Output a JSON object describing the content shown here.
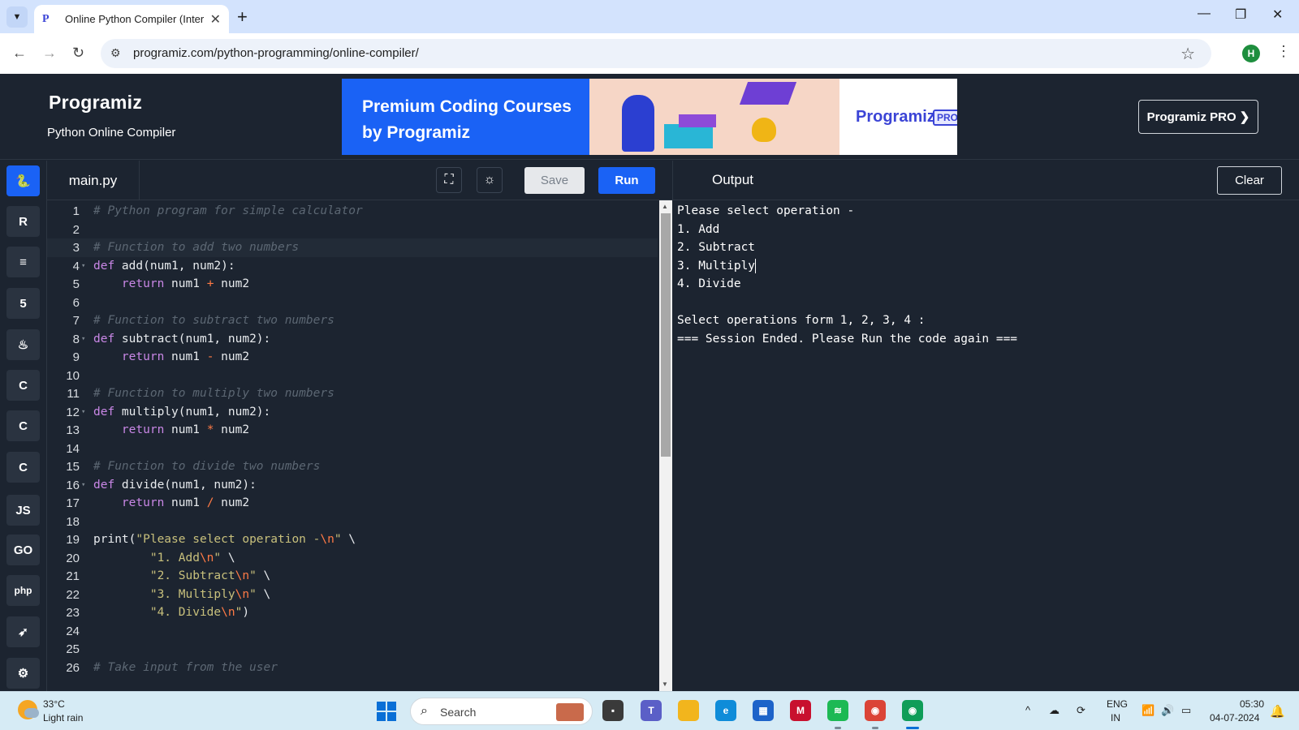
{
  "browser": {
    "tab_title": "Online Python Compiler (Interp",
    "url": "programiz.com/python-programming/online-compiler/"
  },
  "site": {
    "logo": "Programiz",
    "subtitle": "Python Online Compiler",
    "banner_text": "Premium Coding Courses by Programiz",
    "banner_logo": "Programiz",
    "banner_badge": "PRO",
    "pro_button": "Programiz PRO ❯"
  },
  "sidebar": {
    "items": [
      {
        "name": "python",
        "icon": "python-icon",
        "glyph": "🐍",
        "active": true
      },
      {
        "name": "r",
        "icon": "r-icon",
        "glyph": "R",
        "active": false
      },
      {
        "name": "sql",
        "icon": "database-icon",
        "glyph": "≡",
        "active": false
      },
      {
        "name": "html",
        "icon": "html5-icon",
        "glyph": "5",
        "active": false
      },
      {
        "name": "java",
        "icon": "java-icon",
        "glyph": "♨",
        "active": false
      },
      {
        "name": "c",
        "icon": "c-icon",
        "glyph": "C",
        "active": false
      },
      {
        "name": "cpp",
        "icon": "cpp-icon",
        "glyph": "C",
        "active": false
      },
      {
        "name": "csharp",
        "icon": "csharp-icon",
        "glyph": "C",
        "active": false
      },
      {
        "name": "js",
        "icon": "javascript-icon",
        "glyph": "JS",
        "active": false
      },
      {
        "name": "go",
        "icon": "go-icon",
        "glyph": "GO",
        "active": false
      },
      {
        "name": "php",
        "icon": "php-icon",
        "glyph": "php",
        "active": false
      },
      {
        "name": "swift",
        "icon": "swift-icon",
        "glyph": "➶",
        "active": false
      },
      {
        "name": "rust",
        "icon": "rust-icon",
        "glyph": "⚙",
        "active": false
      }
    ]
  },
  "editor": {
    "file_name": "main.py",
    "save_label": "Save",
    "run_label": "Run",
    "lines": [
      {
        "n": "1",
        "fold": false,
        "hl": false,
        "parts": [
          {
            "t": "# Python program for simple calculator",
            "c": "cm"
          }
        ]
      },
      {
        "n": "2",
        "fold": false,
        "hl": false,
        "parts": []
      },
      {
        "n": "3",
        "fold": false,
        "hl": true,
        "parts": [
          {
            "t": "# Function to add two numbers",
            "c": "cm"
          }
        ]
      },
      {
        "n": "4",
        "fold": true,
        "hl": false,
        "parts": [
          {
            "t": "def",
            "c": "kw"
          },
          {
            "t": " add(num1, num2):",
            "c": ""
          }
        ]
      },
      {
        "n": "5",
        "fold": false,
        "hl": false,
        "parts": [
          {
            "t": "    ",
            "c": ""
          },
          {
            "t": "return",
            "c": "kw"
          },
          {
            "t": " num1 ",
            "c": ""
          },
          {
            "t": "+",
            "c": "op"
          },
          {
            "t": " num2",
            "c": ""
          }
        ]
      },
      {
        "n": "6",
        "fold": false,
        "hl": false,
        "parts": []
      },
      {
        "n": "7",
        "fold": false,
        "hl": false,
        "parts": [
          {
            "t": "# Function to subtract two numbers",
            "c": "cm"
          }
        ]
      },
      {
        "n": "8",
        "fold": true,
        "hl": false,
        "parts": [
          {
            "t": "def",
            "c": "kw"
          },
          {
            "t": " subtract(num1, num2):",
            "c": ""
          }
        ]
      },
      {
        "n": "9",
        "fold": false,
        "hl": false,
        "parts": [
          {
            "t": "    ",
            "c": ""
          },
          {
            "t": "return",
            "c": "kw"
          },
          {
            "t": " num1 ",
            "c": ""
          },
          {
            "t": "-",
            "c": "op"
          },
          {
            "t": " num2",
            "c": ""
          }
        ]
      },
      {
        "n": "10",
        "fold": false,
        "hl": false,
        "parts": []
      },
      {
        "n": "11",
        "fold": false,
        "hl": false,
        "parts": [
          {
            "t": "# Function to multiply two numbers",
            "c": "cm"
          }
        ]
      },
      {
        "n": "12",
        "fold": true,
        "hl": false,
        "parts": [
          {
            "t": "def",
            "c": "kw"
          },
          {
            "t": " multiply(num1, num2):",
            "c": ""
          }
        ]
      },
      {
        "n": "13",
        "fold": false,
        "hl": false,
        "parts": [
          {
            "t": "    ",
            "c": ""
          },
          {
            "t": "return",
            "c": "kw"
          },
          {
            "t": " num1 ",
            "c": ""
          },
          {
            "t": "*",
            "c": "op"
          },
          {
            "t": " num2",
            "c": ""
          }
        ]
      },
      {
        "n": "14",
        "fold": false,
        "hl": false,
        "parts": []
      },
      {
        "n": "15",
        "fold": false,
        "hl": false,
        "parts": [
          {
            "t": "# Function to divide two numbers",
            "c": "cm"
          }
        ]
      },
      {
        "n": "16",
        "fold": true,
        "hl": false,
        "parts": [
          {
            "t": "def",
            "c": "kw"
          },
          {
            "t": " divide(num1, num2):",
            "c": ""
          }
        ]
      },
      {
        "n": "17",
        "fold": false,
        "hl": false,
        "parts": [
          {
            "t": "    ",
            "c": ""
          },
          {
            "t": "return",
            "c": "kw"
          },
          {
            "t": " num1 ",
            "c": ""
          },
          {
            "t": "/",
            "c": "op"
          },
          {
            "t": " num2",
            "c": ""
          }
        ]
      },
      {
        "n": "18",
        "fold": false,
        "hl": false,
        "parts": []
      },
      {
        "n": "19",
        "fold": false,
        "hl": false,
        "parts": [
          {
            "t": "print(",
            "c": ""
          },
          {
            "t": "\"Please select operation -",
            "c": "st"
          },
          {
            "t": "\\n",
            "c": "esc"
          },
          {
            "t": "\"",
            "c": "st"
          },
          {
            "t": " \\",
            "c": ""
          }
        ]
      },
      {
        "n": "20",
        "fold": false,
        "hl": false,
        "parts": [
          {
            "t": "        ",
            "c": ""
          },
          {
            "t": "\"1. Add",
            "c": "st"
          },
          {
            "t": "\\n",
            "c": "esc"
          },
          {
            "t": "\"",
            "c": "st"
          },
          {
            "t": " \\",
            "c": ""
          }
        ]
      },
      {
        "n": "21",
        "fold": false,
        "hl": false,
        "parts": [
          {
            "t": "        ",
            "c": ""
          },
          {
            "t": "\"2. Subtract",
            "c": "st"
          },
          {
            "t": "\\n",
            "c": "esc"
          },
          {
            "t": "\"",
            "c": "st"
          },
          {
            "t": " \\",
            "c": ""
          }
        ]
      },
      {
        "n": "22",
        "fold": false,
        "hl": false,
        "parts": [
          {
            "t": "        ",
            "c": ""
          },
          {
            "t": "\"3. Multiply",
            "c": "st"
          },
          {
            "t": "\\n",
            "c": "esc"
          },
          {
            "t": "\"",
            "c": "st"
          },
          {
            "t": " \\",
            "c": ""
          }
        ]
      },
      {
        "n": "23",
        "fold": false,
        "hl": false,
        "parts": [
          {
            "t": "        ",
            "c": ""
          },
          {
            "t": "\"4. Divide",
            "c": "st"
          },
          {
            "t": "\\n",
            "c": "esc"
          },
          {
            "t": "\"",
            "c": "st"
          },
          {
            "t": ")",
            "c": ""
          }
        ]
      },
      {
        "n": "24",
        "fold": false,
        "hl": false,
        "parts": []
      },
      {
        "n": "25",
        "fold": false,
        "hl": false,
        "parts": []
      },
      {
        "n": "26",
        "fold": false,
        "hl": false,
        "parts": [
          {
            "t": "# Take input from the user",
            "c": "cm"
          }
        ]
      }
    ]
  },
  "output": {
    "label": "Output",
    "clear_label": "Clear",
    "lines": [
      "Please select operation -",
      "1. Add",
      "2. Subtract",
      "3. Multiply",
      "4. Divide",
      "",
      "Select operations form 1, 2, 3, 4 :",
      "=== Session Ended. Please Run the code again ==="
    ]
  },
  "taskbar": {
    "temperature": "33°C",
    "weather": "Light rain",
    "search_placeholder": "Search",
    "lang_line1": "ENG",
    "lang_line2": "IN",
    "time": "05:30",
    "date": "04-07-2024",
    "apps": [
      {
        "icon": "file-explorer-icon",
        "color": "#3a3a3a",
        "glyph": "▪"
      },
      {
        "icon": "teams-icon",
        "color": "#5b5fc7",
        "glyph": "T"
      },
      {
        "icon": "folder-icon",
        "color": "#f2b51d",
        "glyph": ""
      },
      {
        "icon": "edge-icon",
        "color": "#0f8cd9",
        "glyph": "e"
      },
      {
        "icon": "store-icon",
        "color": "#1d63c9",
        "glyph": "▦"
      },
      {
        "icon": "mcafee-icon",
        "color": "#c8102e",
        "glyph": "M"
      },
      {
        "icon": "spotify-icon",
        "color": "#1db954",
        "glyph": "≋"
      },
      {
        "icon": "chrome-icon",
        "color": "#db4437",
        "glyph": "◉"
      },
      {
        "icon": "chrome-profile-icon",
        "color": "#0f9d58",
        "glyph": "◉"
      }
    ]
  }
}
